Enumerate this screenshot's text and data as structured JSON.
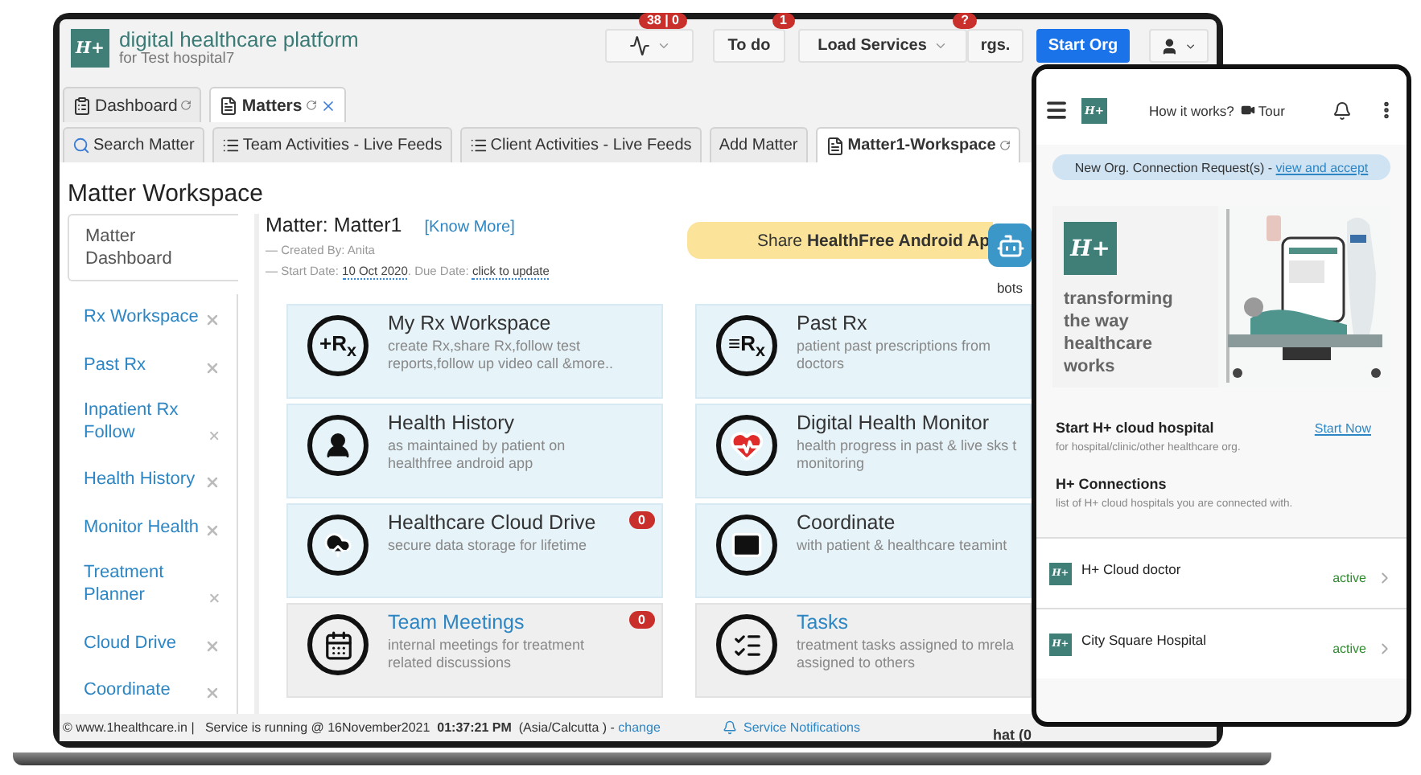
{
  "header": {
    "logo": "H+",
    "title": "digital healthcare platform",
    "subtitle": "for Test hospital7",
    "buttons": [
      {
        "kind": "pulse",
        "badge": "38 | 0"
      },
      {
        "kind": "text",
        "label": "To do",
        "badge": "1"
      },
      {
        "kind": "dropdown",
        "label": "Load Services",
        "badge": "?"
      },
      {
        "kind": "text",
        "label": "rgs."
      },
      {
        "kind": "primary",
        "label": "Start Org"
      },
      {
        "kind": "user"
      }
    ]
  },
  "main_tabs": [
    {
      "kind": "clipboard",
      "label": "Dashboard",
      "selected": false,
      "closable": false
    },
    {
      "kind": "document",
      "label": "Matters",
      "selected": true,
      "closable": true
    }
  ],
  "sub_tabs": [
    {
      "kind": "search",
      "label": "Search Matter",
      "selected": false
    },
    {
      "kind": "list",
      "label": "Team Activities - Live Feeds",
      "selected": false
    },
    {
      "kind": "list",
      "label": "Client Activities - Live Feeds",
      "selected": false
    },
    {
      "kind": "plain",
      "label": "Add Matter",
      "selected": false
    },
    {
      "kind": "document",
      "label": "Matter1-Workspace",
      "selected": true
    }
  ],
  "workspace": {
    "title": "Matter Workspace",
    "sidebar": [
      {
        "label": "Matter Dashboard",
        "selected": true
      },
      {
        "label": "Rx Workspace",
        "selected": false
      },
      {
        "label": "Past Rx",
        "selected": false
      },
      {
        "label": "Inpatient Rx Follow",
        "selected": false
      },
      {
        "label": "Health History",
        "selected": false
      },
      {
        "label": "Monitor Health",
        "selected": false
      },
      {
        "label": "Treatment Planner",
        "selected": false
      },
      {
        "label": "Cloud Drive",
        "selected": false
      },
      {
        "label": "Coordinate",
        "selected": false
      }
    ],
    "matter": {
      "heading": "Matter: Matter1",
      "link": "[Know More]",
      "created": "— Created By: Anita",
      "start_label": "— Start Date:",
      "start_value": "10 Oct 2020",
      "due_label": ". Due Date:",
      "due_value": "click to update"
    },
    "share": "Share **HealthFree Android Ap**",
    "bots": "bots",
    "cards": [
      {
        "title": "My Rx Workspace",
        "desc": [
          "create Rx,share Rx,follow test",
          "reports,follow up video call &more.."
        ],
        "icon_label": "+R$_{x}$",
        "linked": false
      },
      {
        "title": "Past Rx",
        "desc": [
          "patient past prescriptions from",
          "doctors"
        ],
        "icon_label": "≡R$_{x}$",
        "linked": false
      },
      {
        "title": "Health History",
        "desc": [
          "as maintained by patient on",
          "healthfree android app"
        ],
        "linked": false
      },
      {
        "title": "Digital Health Monitor",
        "desc": [
          "health progress in past & live sks t",
          "monitoring"
        ],
        "linked": false
      },
      {
        "title": "Healthcare Cloud Drive",
        "desc": [
          "secure data storage for lifetime"
        ],
        "badge": "0",
        "linked": false
      },
      {
        "title": "Coordinate",
        "desc": [
          "with patient & healthcare teamint"
        ],
        "linked": false
      },
      {
        "title": "Team Meetings",
        "desc": [
          "internal meetings for treatment",
          "related discussions"
        ],
        "badge": "0",
        "linked": true
      },
      {
        "title": "Tasks",
        "desc": [
          "treatment tasks assigned to mrela",
          "assigned to others"
        ],
        "linked": true
      }
    ]
  },
  "status_bar": {
    "text": "© www.1healthcare.in |   Service is running @ 16November2021  **01:37:21 PM**  (Asia/Calcutta ) - ",
    "link": "change",
    "notifications": "Service Notifications",
    "chat": "hat (0"
  },
  "phone": {
    "logo": "H+",
    "how": "How it works?",
    "tour": "Tour",
    "banner": {
      "text": "New Org. Connection Request(s) - ",
      "link": "view and accept"
    },
    "hero": {
      "logo": "H+",
      "tagline": "transforming the way healthcare works"
    },
    "start": {
      "title": "Start H+ cloud hospital",
      "subtitle": "for hospital/clinic/other healthcare org.",
      "link": "Start Now"
    },
    "connections": {
      "title": "H+ Connections",
      "subtitle": "list of H+ cloud hospitals you are connected with.",
      "items": [
        {
          "logo": "H+",
          "name": "H+ Cloud doctor",
          "status": "active"
        },
        {
          "logo": "H+",
          "name": "City Square Hospital",
          "status": "active"
        }
      ]
    }
  }
}
